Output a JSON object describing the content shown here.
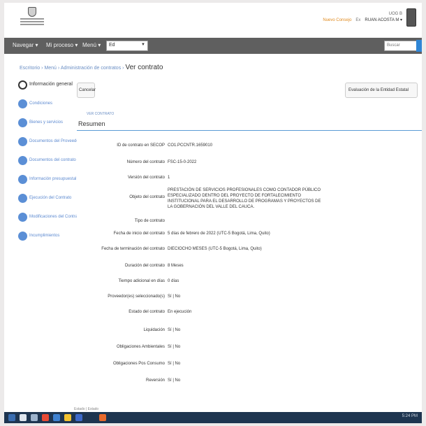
{
  "header": {
    "link": "Nuevo Consejo",
    "exit": "Ex",
    "user_line1": "UOG B",
    "user_line2": "RUAN ACOSTA M ▾"
  },
  "nav": {
    "items": [
      "Navegar ▾",
      "Mi proceso ▾",
      "Menú ▾"
    ],
    "select_value": "Ed",
    "search_placeholder": "Buscar"
  },
  "breadcrumb": {
    "items": [
      "Escritorio",
      "Menú",
      "Administración de contratos"
    ],
    "separator": "›",
    "current": "Ver contrato"
  },
  "sidebar": {
    "items": [
      {
        "label": "Información general"
      },
      {
        "label": "Condiciones"
      },
      {
        "label": "Bienes y servicios"
      },
      {
        "label": "Documentos del Proveedor"
      },
      {
        "label": "Documentos del contrato"
      },
      {
        "label": "Información presupuestal"
      },
      {
        "label": "Ejecución del Contrato"
      },
      {
        "label": "Modificaciones del Contrato"
      },
      {
        "label": "Incumplimientos"
      }
    ]
  },
  "content": {
    "cancel_label": "Cancelar",
    "right_button": "Evaluación de la Entidad Estatal",
    "ver_link": "VER CONTRATO",
    "section_title": "Resumen",
    "fields": [
      {
        "label": "ID de contrato en SECOP",
        "value": "CO1.PCCNTR.1659010"
      },
      {
        "label": "Número del contrato",
        "value": "FSC-15-0-2022"
      },
      {
        "label": "Versión del contrato",
        "value": "1"
      },
      {
        "label": "Objeto del contrato",
        "value": "PRESTACIÓN DE SERVICIOS PROFESIONALES COMO CONTADOR PÚBLICO ESPECIALIZADO DENTRO DEL PROYECTO DE FORTALECIMIENTO INSTITUCIONAL PARA EL DESARROLLO DE PROGRAMAS Y PROYECTOS DE LA GOBERNACIÓN DEL VALLE DEL CAUCA."
      },
      {
        "label": "Tipo de contrato",
        "value": ""
      },
      {
        "label": "Fecha de inicio del contrato",
        "value": "5 días de febrero de 2022 (UTC-5 Bogotá, Lima, Quito)"
      },
      {
        "label": "Fecha de terminación del contrato",
        "value": "DIECIOCHO MESES (UTC-5 Bogotá, Lima, Quito)"
      },
      {
        "label": "Duración del contrato",
        "value": "8 Meses"
      },
      {
        "label": "Tiempo adicional en días",
        "value": "0 días"
      },
      {
        "label": "Proveedor(es) seleccionado(s)",
        "value": "Sí | No"
      },
      {
        "label": "Estado del contrato",
        "value": "En ejecución"
      },
      {
        "label": "Liquidación",
        "value": "Sí | No"
      },
      {
        "label": "Obligaciones Ambientales",
        "value": "Sí | No"
      },
      {
        "label": "Obligaciones Pos Consumo",
        "value": "Sí | No"
      },
      {
        "label": "Reversión",
        "value": "Sí | No"
      }
    ]
  },
  "taskbar": {
    "strip_text": "Estado | Estado",
    "tray_text": "5:24 PM"
  },
  "colors": {
    "accent": "#5b8fd6",
    "nav_bg": "#5f5f5f",
    "taskbar_bg": "#1e3550",
    "link": "#e08a1e"
  }
}
